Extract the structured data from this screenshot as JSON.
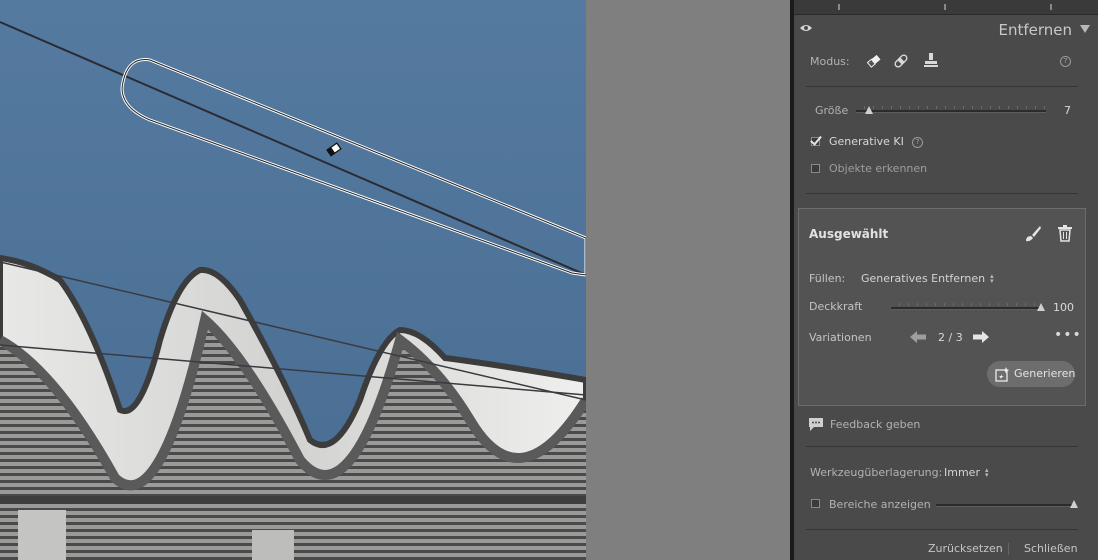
{
  "panel": {
    "title": "Entfernen",
    "modus_label": "Modus:",
    "groesse_label": "Größe",
    "groesse_value": "7",
    "groesse_level": 0.07,
    "generative_ki_label": "Generative KI",
    "generative_ki_checked": true,
    "objekte_label": "Objekte erkennen",
    "objekte_checked": false
  },
  "selected": {
    "title": "Ausgewählt",
    "fill_label": "Füllen:",
    "fill_value": "Generatives Entfernen",
    "opacity_label": "Deckkraft",
    "opacity_value": "100",
    "opacity_level": 1.0,
    "variations_label": "Variationen",
    "variations_value": "2 / 3",
    "generate_label": "Generieren"
  },
  "feedback_label": "Feedback geben",
  "overlay": {
    "label": "Werkzeugüberlagerung:",
    "value": "Immer",
    "areas_label": "Bereiche anzeigen",
    "areas_checked": false
  },
  "footer": {
    "reset_label": "Zurücksetzen",
    "close_label": "Schließen"
  },
  "colors": {
    "sky": "#4b6e94",
    "panel": "#4a4a4a",
    "selected_box": "#535353"
  }
}
